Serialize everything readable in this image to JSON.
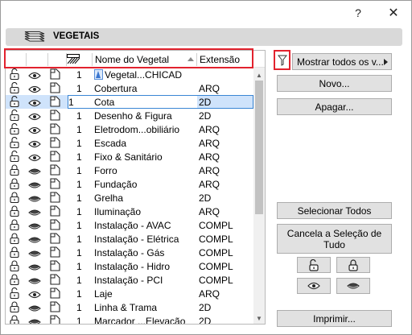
{
  "window": {
    "help_label": "?",
    "close_label": "✕"
  },
  "header": {
    "title": "VEGETAIS",
    "icon": "layers-icon"
  },
  "columns": {
    "name": "Nome do Vegetal",
    "extension": "Extensão",
    "icon_hatch": "hatch-pattern-icon"
  },
  "rows": [
    {
      "visible": true,
      "locked": false,
      "pen": "1",
      "name": "Vegetal...CHICAD",
      "ext": "",
      "special": true
    },
    {
      "visible": true,
      "locked": false,
      "pen": "1",
      "name": "Cobertura",
      "ext": "ARQ"
    },
    {
      "visible": true,
      "locked": false,
      "pen": "1",
      "name": "Cota",
      "ext": "2D",
      "selected": true
    },
    {
      "visible": true,
      "locked": false,
      "pen": "1",
      "name": "Desenho & Figura",
      "ext": "2D"
    },
    {
      "visible": true,
      "locked": false,
      "pen": "1",
      "name": "Eletrodom...obiliário",
      "ext": "ARQ"
    },
    {
      "visible": true,
      "locked": false,
      "pen": "1",
      "name": "Escada",
      "ext": "ARQ"
    },
    {
      "visible": true,
      "locked": false,
      "pen": "1",
      "name": "Fixo & Sanitário",
      "ext": "ARQ"
    },
    {
      "visible": false,
      "locked": true,
      "pen": "1",
      "name": "Forro",
      "ext": "ARQ"
    },
    {
      "visible": false,
      "locked": true,
      "pen": "1",
      "name": "Fundação",
      "ext": "ARQ"
    },
    {
      "visible": false,
      "locked": true,
      "pen": "1",
      "name": "Grelha",
      "ext": "2D"
    },
    {
      "visible": false,
      "locked": true,
      "pen": "1",
      "name": "Iluminação",
      "ext": "ARQ"
    },
    {
      "visible": false,
      "locked": true,
      "pen": "1",
      "name": "Instalação - AVAC",
      "ext": "COMPL"
    },
    {
      "visible": false,
      "locked": true,
      "pen": "1",
      "name": "Instalação - Elétrica",
      "ext": "COMPL"
    },
    {
      "visible": false,
      "locked": true,
      "pen": "1",
      "name": "Instalação - Gás",
      "ext": "COMPL"
    },
    {
      "visible": false,
      "locked": true,
      "pen": "1",
      "name": "Instalação - Hidro",
      "ext": "COMPL"
    },
    {
      "visible": false,
      "locked": true,
      "pen": "1",
      "name": "Instalação - PCI",
      "ext": "COMPL"
    },
    {
      "visible": true,
      "locked": false,
      "pen": "1",
      "name": "Laje",
      "ext": "ARQ"
    },
    {
      "visible": false,
      "locked": true,
      "pen": "1",
      "name": "Linha & Trama",
      "ext": "2D"
    },
    {
      "visible": false,
      "locked": true,
      "pen": "1",
      "name": "Marcador ...Elevação",
      "ext": "2D"
    }
  ],
  "buttons": {
    "show_all": "Mostrar todos os v...",
    "new": "Novo...",
    "delete": "Apagar...",
    "select_all": "Selecionar Todos",
    "cancel_selection": "Cancela a Seleção de Tudo",
    "print": "Imprimir..."
  },
  "colors": {
    "highlight_frame": "#e2222e",
    "selection_fill": "#cfe3fb",
    "selection_border": "#3a86d4"
  }
}
